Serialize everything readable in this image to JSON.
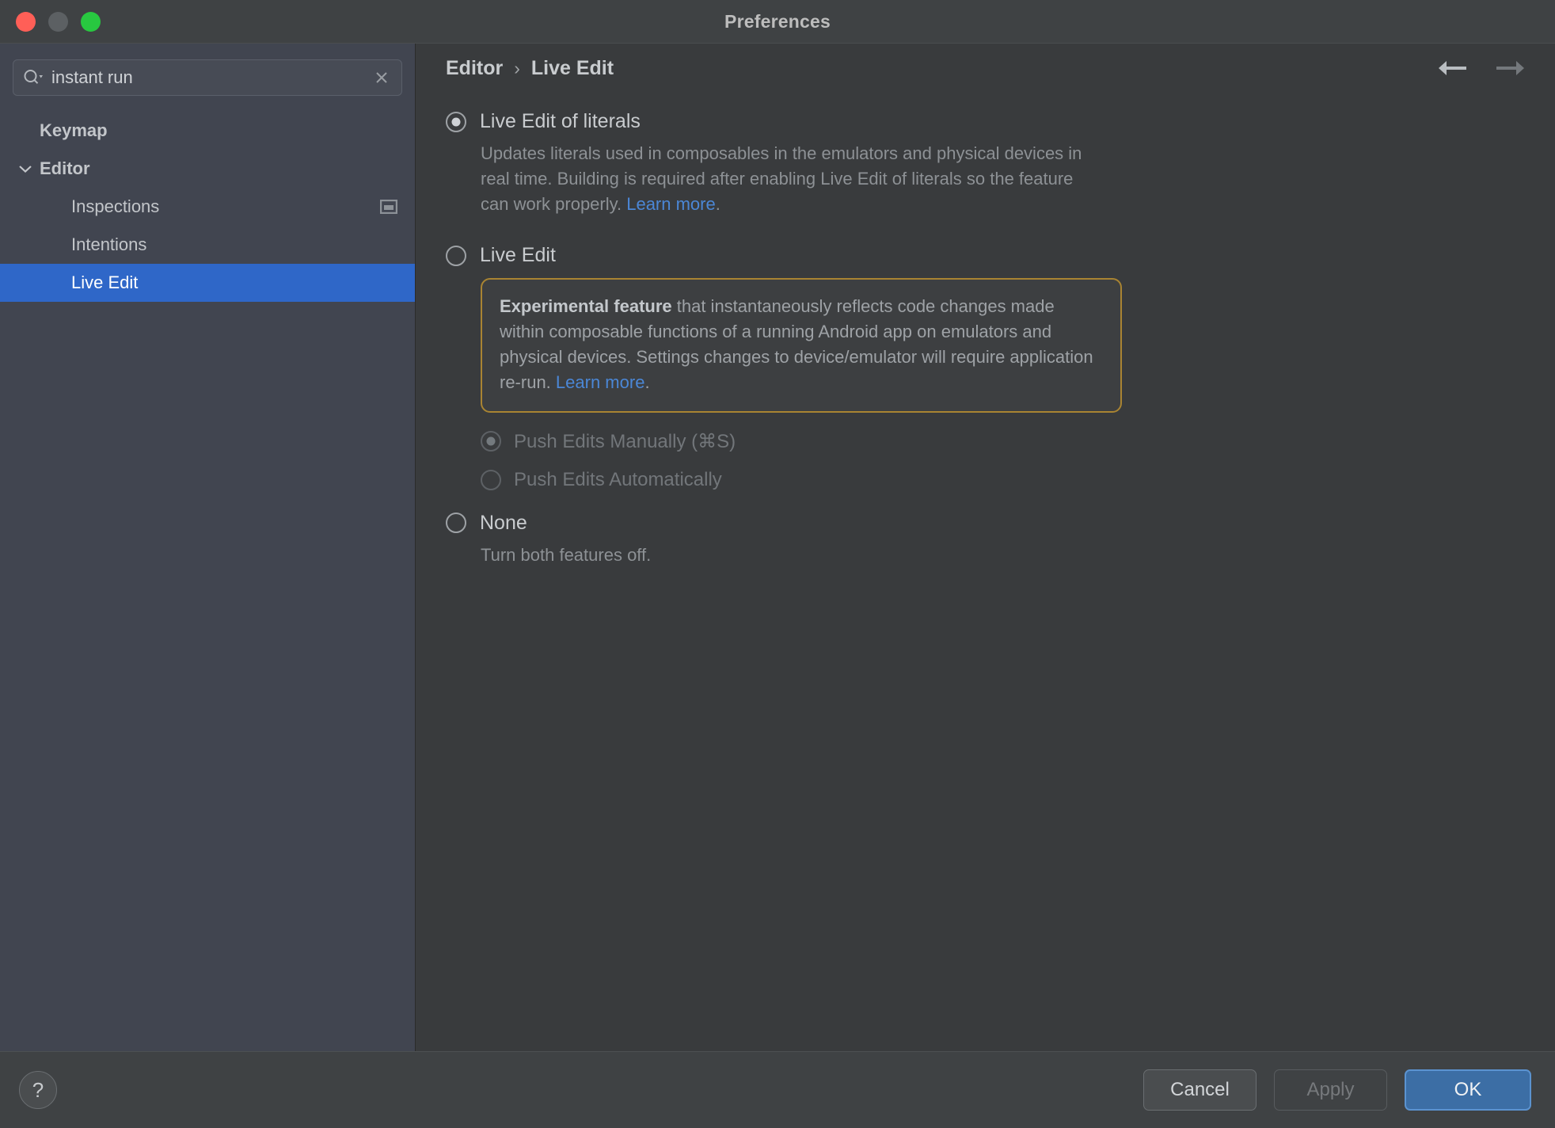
{
  "window": {
    "title": "Preferences",
    "traffic_lights": [
      "close-button",
      "minimize-button",
      "maximize-button"
    ]
  },
  "sidebar": {
    "search": {
      "value": "instant run",
      "placeholder": "Search settings",
      "search_icon": "search-icon",
      "clear_icon": "clear-icon"
    },
    "items": [
      {
        "label": "Keymap",
        "level": 0,
        "bold": true,
        "selected": false,
        "twisty": "",
        "icon": ""
      },
      {
        "label": "Editor",
        "level": 0,
        "bold": true,
        "selected": false,
        "twisty": "chevron-down",
        "icon": ""
      },
      {
        "label": "Inspections",
        "level": 1,
        "bold": false,
        "selected": false,
        "twisty": "",
        "icon": "window-icon"
      },
      {
        "label": "Intentions",
        "level": 1,
        "bold": false,
        "selected": false,
        "twisty": "",
        "icon": ""
      },
      {
        "label": "Live Edit",
        "level": 1,
        "bold": false,
        "selected": true,
        "twisty": "",
        "icon": ""
      }
    ]
  },
  "content": {
    "breadcrumb": {
      "parent": "Editor",
      "separator": "›",
      "current": "Live Edit"
    },
    "nav": {
      "back_icon": "arrow-left-icon",
      "forward_icon": "arrow-right-icon"
    },
    "options": [
      {
        "id": "live-edit-of-literals",
        "label": "Live Edit of literals",
        "checked": true,
        "enabled": true,
        "description_before_link": "Updates literals used in composables in the emulators and physical devices in real time. Building is required after enabling Live Edit of literals so the feature can work properly. ",
        "link_text": "Learn more",
        "description_after_link": "."
      },
      {
        "id": "live-edit",
        "label": "Live Edit",
        "checked": false,
        "enabled": true,
        "callout": {
          "bold_lead": "Experimental feature",
          "body_before_link": " that instantaneously reflects code changes made within composable functions of a running Android app on emulators and physical devices. Settings changes to device/emulator will require application re-run. ",
          "link_text": "Learn more",
          "body_after_link": "."
        },
        "suboptions": [
          {
            "id": "push-edits-manually",
            "label": "Push Edits Manually (⌘S)",
            "checked": true,
            "enabled": false
          },
          {
            "id": "push-edits-automatically",
            "label": "Push Edits Automatically",
            "checked": false,
            "enabled": false
          }
        ]
      },
      {
        "id": "none",
        "label": "None",
        "checked": false,
        "enabled": true,
        "description_before_link": "Turn both features off.",
        "link_text": "",
        "description_after_link": ""
      }
    ]
  },
  "footer": {
    "help_label": "?",
    "cancel_label": "Cancel",
    "apply_label": "Apply",
    "apply_enabled": false,
    "ok_label": "OK"
  },
  "colors": {
    "selection_blue": "#2f67c8",
    "primary_button": "#3c6ea5",
    "link_blue": "#4b87d6",
    "callout_border": "#a98432",
    "sidebar_bg": "#414550",
    "content_bg": "#393b3d"
  }
}
